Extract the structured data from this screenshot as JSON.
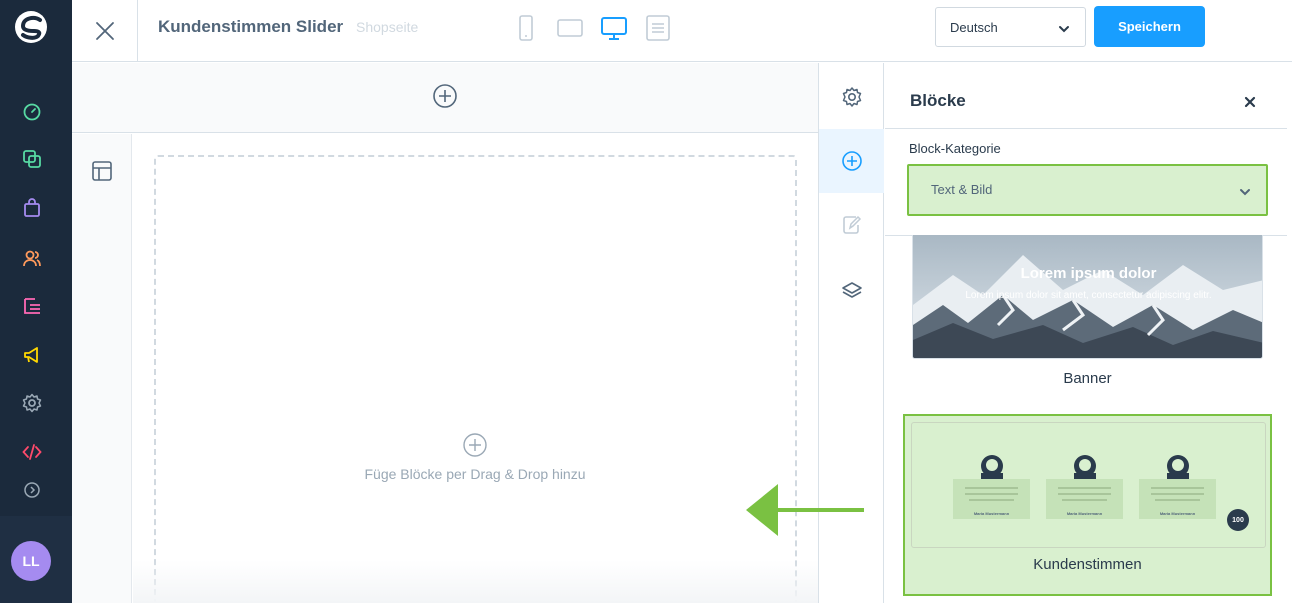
{
  "sidebar": {
    "icons": [
      "dashboard-icon",
      "catalog-icon",
      "orders-icon",
      "customers-icon",
      "content-icon",
      "marketing-icon",
      "settings-icon",
      "code-icon",
      "expand-icon"
    ],
    "avatar_initials": "LL",
    "colors": {
      "bg": "#1b2a3c",
      "dashboard": "#57d9a3",
      "catalog": "#57d9a3",
      "orders": "#a58bf0",
      "customers": "#ff9a5c",
      "content": "#ff68b4",
      "marketing": "#ffd700",
      "settings": "#9aa8b5",
      "code": "#ff4a6b"
    }
  },
  "topbar": {
    "title": "Kundenstimmen Slider",
    "subtitle": "Shopseite",
    "language": "Deutsch",
    "save_label": "Speichern"
  },
  "canvas": {
    "drop_hint": "Füge Blöcke per Drag & Drop hinzu"
  },
  "panel": {
    "title": "Blöcke",
    "category_label": "Block-Kategorie",
    "category_value": "Text & Bild",
    "blocks": [
      {
        "label": "Banner",
        "preview_title": "Lorem ipsum dolor",
        "preview_text": "Lorem ipsum dolor sit amet, consectetur adipiscing elitr."
      },
      {
        "label": "Kundenstimmen",
        "testimonial_name": "Maria Mustermann",
        "badge": "100"
      }
    ]
  },
  "colors": {
    "accent": "#189eff",
    "highlight_green": "#7ac142",
    "highlight_fill": "#d9f0cf"
  }
}
